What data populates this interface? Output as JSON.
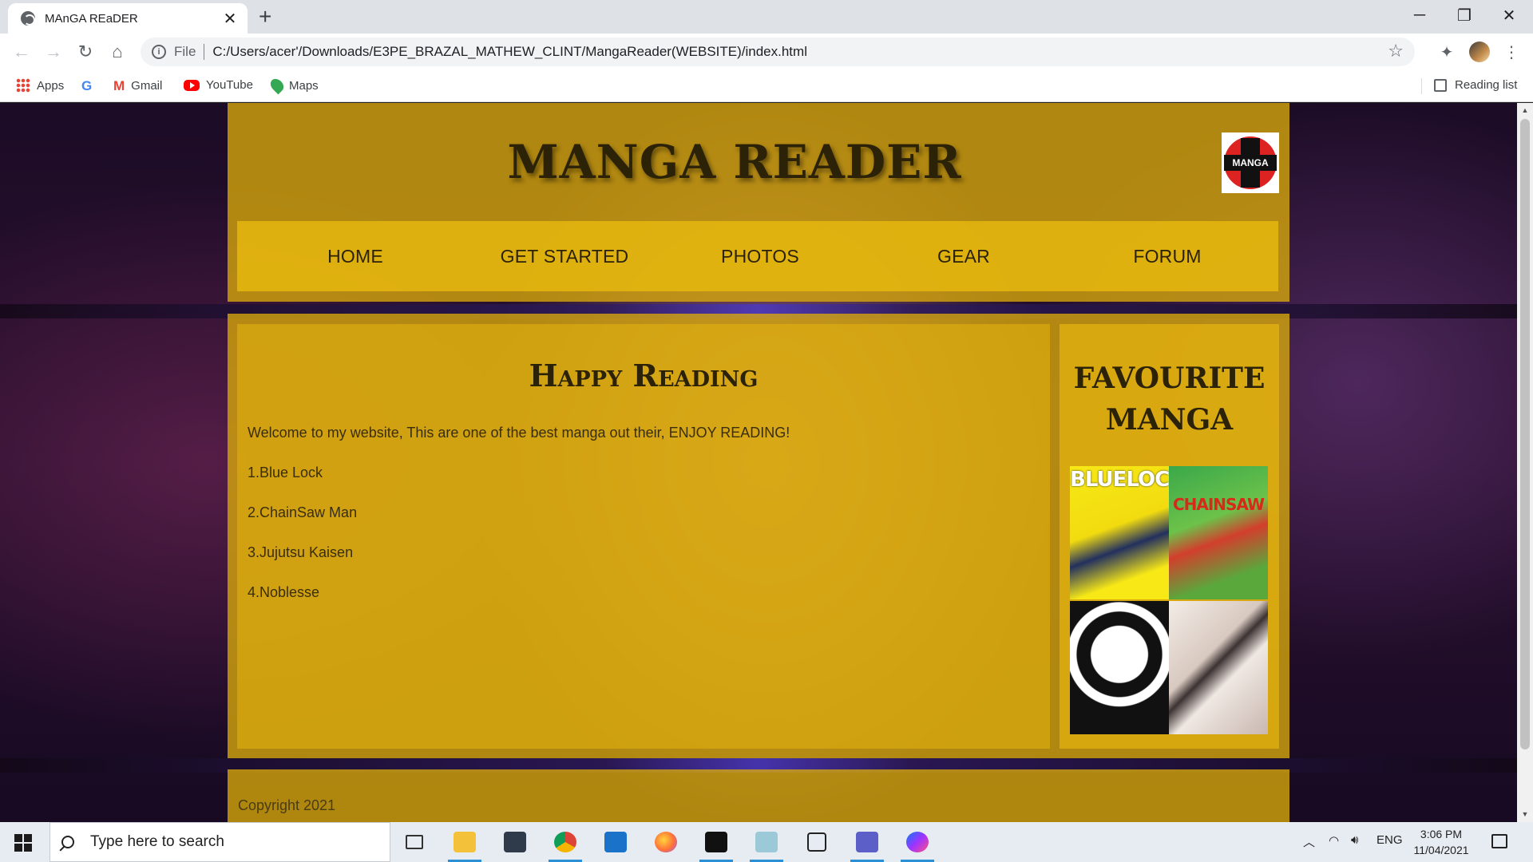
{
  "browser": {
    "tab_title": "MAnGA REaDER",
    "tab_close": "✕",
    "new_tab": "+",
    "address_scheme": "File",
    "address_url": "C:/Users/acer'/Downloads/E3PE_BRAZAL_MATHEW_CLINT/MangaReader(WEBSITE)/index.html",
    "window_controls": [
      "─",
      "❐",
      "✕"
    ],
    "bookmarks": [
      {
        "label": "Apps",
        "icon": "apps-grid-icon"
      },
      {
        "label": "",
        "icon": "google-icon"
      },
      {
        "label": "Gmail",
        "icon": "gmail-icon"
      },
      {
        "label": "YouTube",
        "icon": "youtube-icon"
      },
      {
        "label": "Maps",
        "icon": "maps-icon"
      }
    ],
    "reading_list": "Reading list",
    "google_glyph": "G",
    "gmail_glyph": "M"
  },
  "site": {
    "title": "MANGA READER",
    "logo_text": "MANGA",
    "nav": [
      "HOME",
      "GET STARTED",
      "PHOTOS",
      "GEAR",
      "FORUM"
    ],
    "main_heading": "Happy Reading",
    "welcome_text": "Welcome to my website, This are one of the best manga out their, ENJOY READING!",
    "manga_list": [
      "1.Blue Lock",
      "2.ChainSaw Man",
      "3.Jujutsu Kaisen",
      "4.Noblesse"
    ],
    "side_heading_line1": "FAVOURITE",
    "side_heading_line2": "MANGA",
    "thumbnails": [
      {
        "label": "BLUELOCK"
      },
      {
        "label": "CHAINSAW"
      },
      {
        "label": ""
      },
      {
        "label": ""
      }
    ],
    "copyright": "Copyright 2021"
  },
  "taskbar": {
    "search_placeholder": "Type here to search",
    "language": "ENG",
    "time": "3:06 PM",
    "date": "11/04/2021"
  },
  "colors": {
    "panel_gold": "#daaa0a",
    "heading_text": "#2b2208",
    "background_purple": "#2a1030"
  }
}
